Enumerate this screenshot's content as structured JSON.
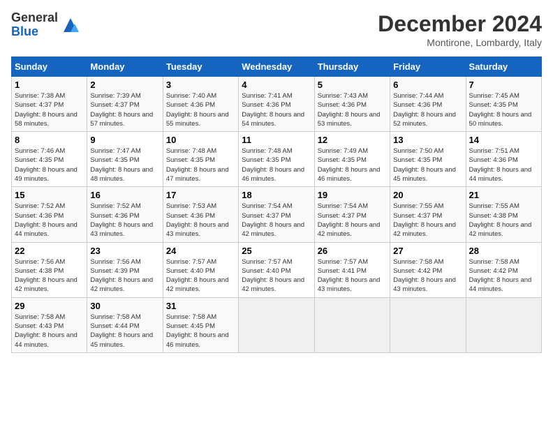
{
  "logo": {
    "general": "General",
    "blue": "Blue"
  },
  "title": "December 2024",
  "location": "Montirone, Lombardy, Italy",
  "days_header": [
    "Sunday",
    "Monday",
    "Tuesday",
    "Wednesday",
    "Thursday",
    "Friday",
    "Saturday"
  ],
  "weeks": [
    [
      {
        "day": "1",
        "sunrise": "Sunrise: 7:38 AM",
        "sunset": "Sunset: 4:37 PM",
        "daylight": "Daylight: 8 hours and 58 minutes."
      },
      {
        "day": "2",
        "sunrise": "Sunrise: 7:39 AM",
        "sunset": "Sunset: 4:37 PM",
        "daylight": "Daylight: 8 hours and 57 minutes."
      },
      {
        "day": "3",
        "sunrise": "Sunrise: 7:40 AM",
        "sunset": "Sunset: 4:36 PM",
        "daylight": "Daylight: 8 hours and 55 minutes."
      },
      {
        "day": "4",
        "sunrise": "Sunrise: 7:41 AM",
        "sunset": "Sunset: 4:36 PM",
        "daylight": "Daylight: 8 hours and 54 minutes."
      },
      {
        "day": "5",
        "sunrise": "Sunrise: 7:43 AM",
        "sunset": "Sunset: 4:36 PM",
        "daylight": "Daylight: 8 hours and 53 minutes."
      },
      {
        "day": "6",
        "sunrise": "Sunrise: 7:44 AM",
        "sunset": "Sunset: 4:36 PM",
        "daylight": "Daylight: 8 hours and 52 minutes."
      },
      {
        "day": "7",
        "sunrise": "Sunrise: 7:45 AM",
        "sunset": "Sunset: 4:35 PM",
        "daylight": "Daylight: 8 hours and 50 minutes."
      }
    ],
    [
      {
        "day": "8",
        "sunrise": "Sunrise: 7:46 AM",
        "sunset": "Sunset: 4:35 PM",
        "daylight": "Daylight: 8 hours and 49 minutes."
      },
      {
        "day": "9",
        "sunrise": "Sunrise: 7:47 AM",
        "sunset": "Sunset: 4:35 PM",
        "daylight": "Daylight: 8 hours and 48 minutes."
      },
      {
        "day": "10",
        "sunrise": "Sunrise: 7:48 AM",
        "sunset": "Sunset: 4:35 PM",
        "daylight": "Daylight: 8 hours and 47 minutes."
      },
      {
        "day": "11",
        "sunrise": "Sunrise: 7:48 AM",
        "sunset": "Sunset: 4:35 PM",
        "daylight": "Daylight: 8 hours and 46 minutes."
      },
      {
        "day": "12",
        "sunrise": "Sunrise: 7:49 AM",
        "sunset": "Sunset: 4:35 PM",
        "daylight": "Daylight: 8 hours and 46 minutes."
      },
      {
        "day": "13",
        "sunrise": "Sunrise: 7:50 AM",
        "sunset": "Sunset: 4:35 PM",
        "daylight": "Daylight: 8 hours and 45 minutes."
      },
      {
        "day": "14",
        "sunrise": "Sunrise: 7:51 AM",
        "sunset": "Sunset: 4:36 PM",
        "daylight": "Daylight: 8 hours and 44 minutes."
      }
    ],
    [
      {
        "day": "15",
        "sunrise": "Sunrise: 7:52 AM",
        "sunset": "Sunset: 4:36 PM",
        "daylight": "Daylight: 8 hours and 44 minutes."
      },
      {
        "day": "16",
        "sunrise": "Sunrise: 7:52 AM",
        "sunset": "Sunset: 4:36 PM",
        "daylight": "Daylight: 8 hours and 43 minutes."
      },
      {
        "day": "17",
        "sunrise": "Sunrise: 7:53 AM",
        "sunset": "Sunset: 4:36 PM",
        "daylight": "Daylight: 8 hours and 43 minutes."
      },
      {
        "day": "18",
        "sunrise": "Sunrise: 7:54 AM",
        "sunset": "Sunset: 4:37 PM",
        "daylight": "Daylight: 8 hours and 42 minutes."
      },
      {
        "day": "19",
        "sunrise": "Sunrise: 7:54 AM",
        "sunset": "Sunset: 4:37 PM",
        "daylight": "Daylight: 8 hours and 42 minutes."
      },
      {
        "day": "20",
        "sunrise": "Sunrise: 7:55 AM",
        "sunset": "Sunset: 4:37 PM",
        "daylight": "Daylight: 8 hours and 42 minutes."
      },
      {
        "day": "21",
        "sunrise": "Sunrise: 7:55 AM",
        "sunset": "Sunset: 4:38 PM",
        "daylight": "Daylight: 8 hours and 42 minutes."
      }
    ],
    [
      {
        "day": "22",
        "sunrise": "Sunrise: 7:56 AM",
        "sunset": "Sunset: 4:38 PM",
        "daylight": "Daylight: 8 hours and 42 minutes."
      },
      {
        "day": "23",
        "sunrise": "Sunrise: 7:56 AM",
        "sunset": "Sunset: 4:39 PM",
        "daylight": "Daylight: 8 hours and 42 minutes."
      },
      {
        "day": "24",
        "sunrise": "Sunrise: 7:57 AM",
        "sunset": "Sunset: 4:40 PM",
        "daylight": "Daylight: 8 hours and 42 minutes."
      },
      {
        "day": "25",
        "sunrise": "Sunrise: 7:57 AM",
        "sunset": "Sunset: 4:40 PM",
        "daylight": "Daylight: 8 hours and 42 minutes."
      },
      {
        "day": "26",
        "sunrise": "Sunrise: 7:57 AM",
        "sunset": "Sunset: 4:41 PM",
        "daylight": "Daylight: 8 hours and 43 minutes."
      },
      {
        "day": "27",
        "sunrise": "Sunrise: 7:58 AM",
        "sunset": "Sunset: 4:42 PM",
        "daylight": "Daylight: 8 hours and 43 minutes."
      },
      {
        "day": "28",
        "sunrise": "Sunrise: 7:58 AM",
        "sunset": "Sunset: 4:42 PM",
        "daylight": "Daylight: 8 hours and 44 minutes."
      }
    ],
    [
      {
        "day": "29",
        "sunrise": "Sunrise: 7:58 AM",
        "sunset": "Sunset: 4:43 PM",
        "daylight": "Daylight: 8 hours and 44 minutes."
      },
      {
        "day": "30",
        "sunrise": "Sunrise: 7:58 AM",
        "sunset": "Sunset: 4:44 PM",
        "daylight": "Daylight: 8 hours and 45 minutes."
      },
      {
        "day": "31",
        "sunrise": "Sunrise: 7:58 AM",
        "sunset": "Sunset: 4:45 PM",
        "daylight": "Daylight: 8 hours and 46 minutes."
      },
      null,
      null,
      null,
      null
    ]
  ]
}
